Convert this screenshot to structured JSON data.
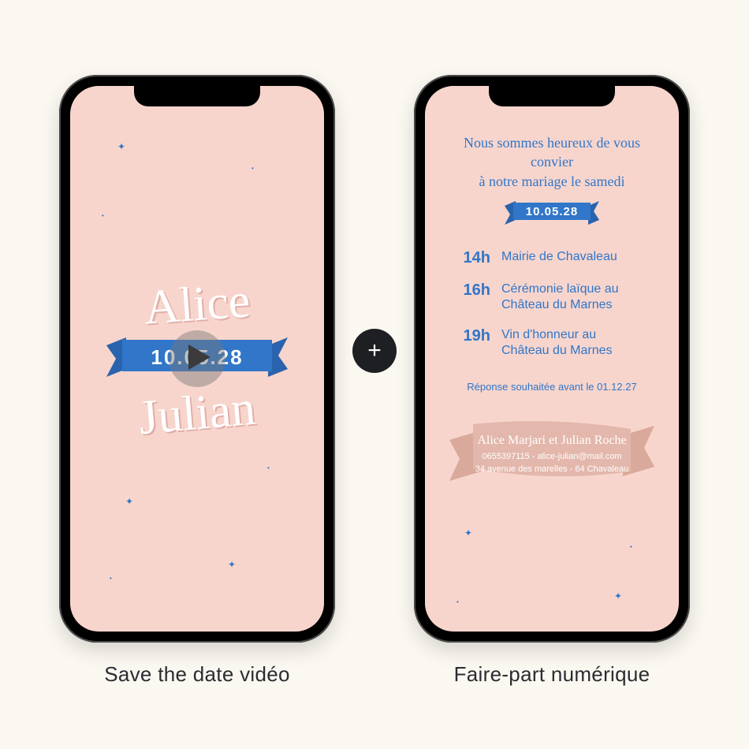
{
  "captions": {
    "left": "Save the date vidéo",
    "right": "Faire-part numérique"
  },
  "plus_label": "+",
  "colors": {
    "background": "#fbf8f1",
    "phone_screen": "#f7d5cd",
    "accent_blue": "#3176c8",
    "footer_ribbon": "#e3b7ab"
  },
  "save_the_date": {
    "name_top": "Alice",
    "name_bottom": "Julian",
    "date": "10.05.28",
    "play_icon": "play-icon"
  },
  "faire_part": {
    "intro_line1": "Nous sommes heureux de vous convier",
    "intro_line2": "à notre mariage le samedi",
    "date": "10.05.28",
    "schedule": [
      {
        "time": "14h",
        "desc": "Mairie de Chavaleau"
      },
      {
        "time": "16h",
        "desc": "Cérémonie laïque au Château du Marnes"
      },
      {
        "time": "19h",
        "desc": "Vin d'honneur au Château du Marnes"
      }
    ],
    "rsvp": "Réponse souhaitée avant le 01.12.27",
    "footer": {
      "names": "Alice Marjari et Julian Roche",
      "contact": "0655397115 - alice-julian@mail.com",
      "address": "34 avenue des marelles - 64 Chavaleau"
    }
  }
}
